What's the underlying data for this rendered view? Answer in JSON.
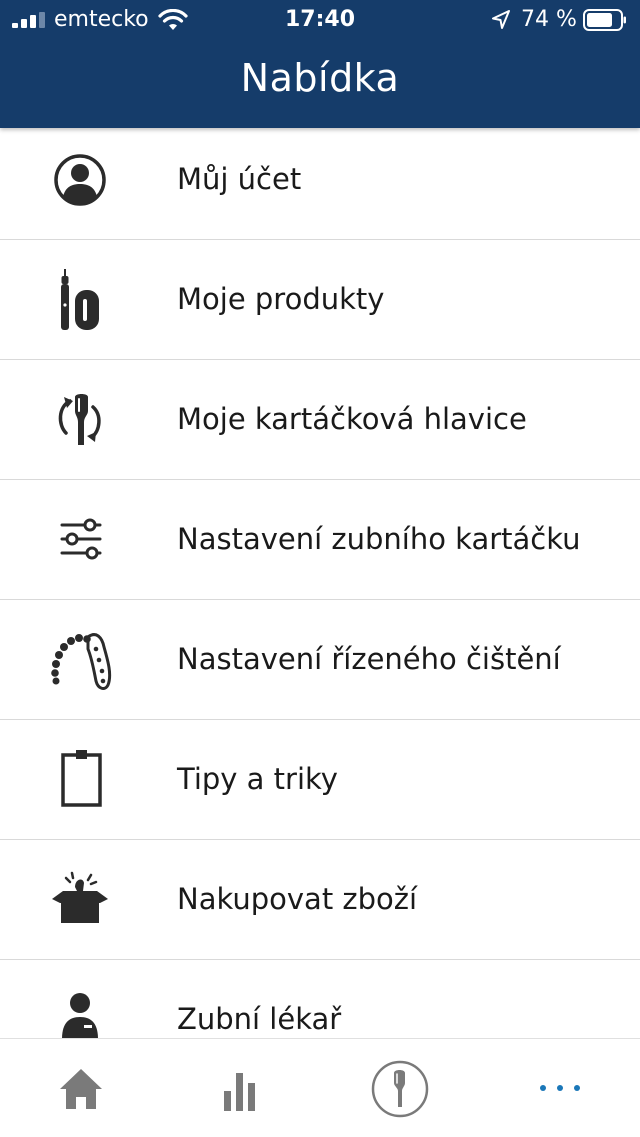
{
  "status_bar": {
    "carrier": "emtecko",
    "time": "17:40",
    "battery_percent": "74 %"
  },
  "header": {
    "title": "Nabídka"
  },
  "menu": {
    "items": [
      {
        "label": "Můj účet",
        "icon": "account-icon"
      },
      {
        "label": "Moje produkty",
        "icon": "toothbrush-icon"
      },
      {
        "label": "Moje kartáčková hlavice",
        "icon": "brush-head-replace-icon"
      },
      {
        "label": "Nastavení zubního kartáčku",
        "icon": "sliders-icon"
      },
      {
        "label": "Nastavení řízeného čištění",
        "icon": "teeth-arch-icon"
      },
      {
        "label": "Tipy a triky",
        "icon": "clipboard-icon"
      },
      {
        "label": "Nakupovat zboží",
        "icon": "shop-box-icon"
      },
      {
        "label": "Zubní lékař",
        "icon": "dentist-icon"
      }
    ]
  },
  "tabbar": {
    "tabs": [
      {
        "name": "home",
        "icon": "home-icon"
      },
      {
        "name": "statistics",
        "icon": "bar-chart-icon"
      },
      {
        "name": "brush",
        "icon": "brush-circle-icon"
      },
      {
        "name": "more",
        "icon": "more-dots-icon",
        "active": true
      }
    ]
  },
  "colors": {
    "header_bg": "#153c6a",
    "icon": "#2b2b2b",
    "tab_icon": "#7a7a7a",
    "active_tab": "#1a77b8",
    "divider": "#d9d9d9"
  }
}
